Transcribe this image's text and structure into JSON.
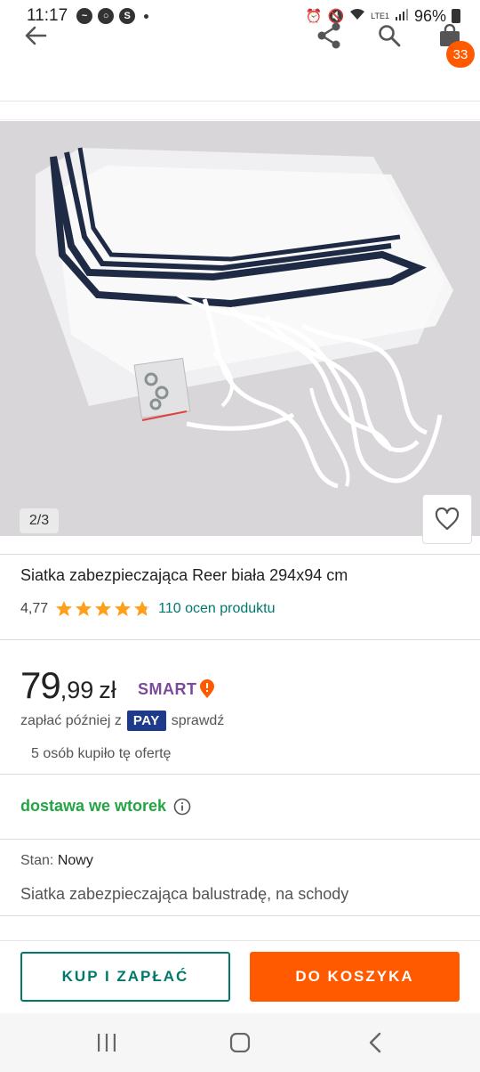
{
  "status_bar": {
    "time": "11:17",
    "battery": "96%",
    "network": "LTE1",
    "app_icons": [
      "messenger-icon",
      "chrome-icon",
      "skype-icon"
    ]
  },
  "header": {
    "cart_count": "33"
  },
  "gallery": {
    "counter": "2/3"
  },
  "product": {
    "title": "Siatka zabezpieczająca Reer biała 294x94 cm",
    "rating_value": "4,77",
    "rating": 4.77,
    "rating_max": 5,
    "reviews_link": "110 ocen produktu"
  },
  "price": {
    "integer": "79",
    "decimal": ",99",
    "currency": "zł",
    "smart_label": "SMART"
  },
  "pay_later": {
    "prefix": "zapłać później z",
    "badge": "PAY",
    "link": "sprawdź"
  },
  "bought_info": "5 osób kupiło tę ofertę",
  "delivery": {
    "text": "dostawa we wtorek"
  },
  "details": {
    "condition_label": "Stan:",
    "condition_value": "Nowy",
    "description": "Siatka zabezpieczająca balustradę, na schody"
  },
  "actions": {
    "buy_label": "KUP I ZAPŁAĆ",
    "cart_label": "DO KOSZYKA"
  },
  "colors": {
    "accent_orange": "#ff5a00",
    "accent_teal": "#00796b",
    "delivery_green": "#22a542",
    "star_orange": "#ff9f1a",
    "smart_purple": "#7b4a9e",
    "pay_blue": "#1e3a8a"
  }
}
